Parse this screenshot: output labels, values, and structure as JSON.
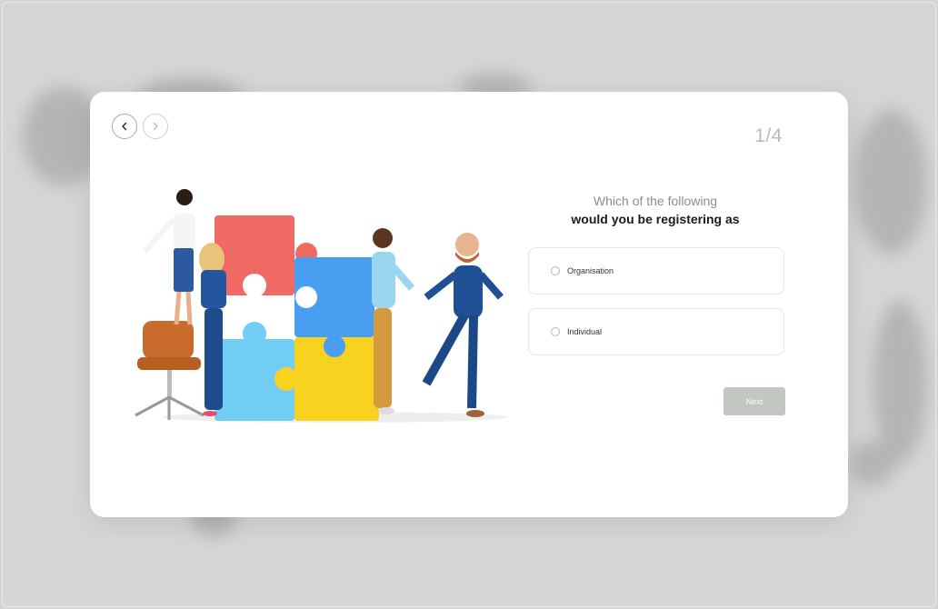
{
  "wizard": {
    "back_icon": "chevron-left-icon",
    "forward_icon": "chevron-right-icon",
    "step_indicator": "1/4"
  },
  "question": {
    "line1": "Which of the following",
    "line2": "would you be registering as"
  },
  "options": [
    {
      "label": "Organisation",
      "selected": false
    },
    {
      "label": "Individual",
      "selected": false
    }
  ],
  "actions": {
    "next_label": "Next",
    "next_color": "#c3c7c1"
  },
  "colors": {
    "puzzle_red": "#f06a63",
    "puzzle_blue": "#4a9ef2",
    "puzzle_light_blue": "#72cdf2",
    "puzzle_yellow": "#f7d21f"
  }
}
